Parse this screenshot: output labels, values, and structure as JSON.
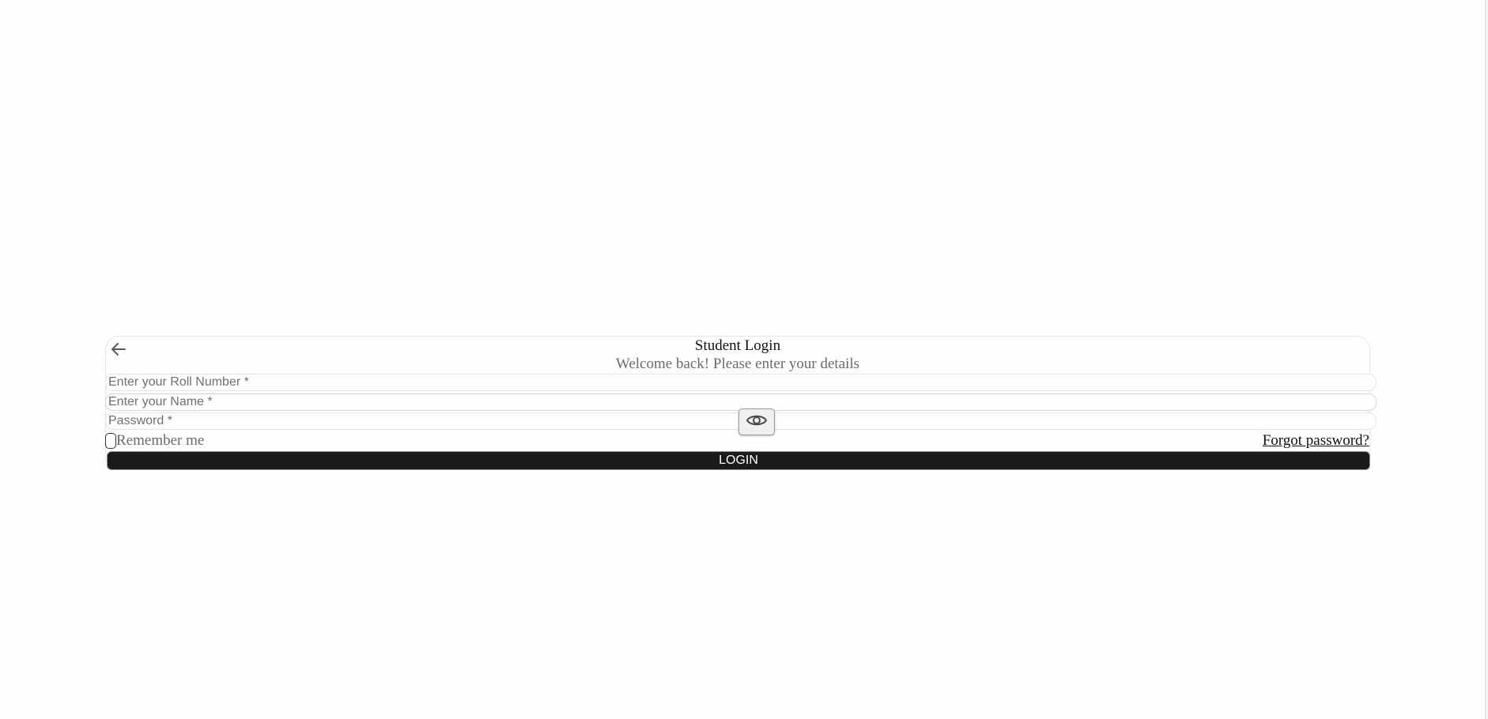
{
  "login_card": {
    "title": "Student Login",
    "subtitle": "Welcome back! Please enter your details",
    "back_icon": "arrow-left-icon",
    "roll_number": {
      "value": "",
      "placeholder": "Enter your Roll Number *"
    },
    "name": {
      "value": "",
      "placeholder": "Enter your Name *"
    },
    "password": {
      "value": "",
      "placeholder": "Password *",
      "toggle_icon": "eye-icon"
    },
    "remember_label": "Remember me",
    "remember_checked": false,
    "forgot_label": "Forgot password?",
    "login_label": "LOGIN"
  },
  "colors": {
    "button_bg": "#1a1a1a",
    "button_text": "#ffffff",
    "muted_text": "#6b6b6b"
  }
}
